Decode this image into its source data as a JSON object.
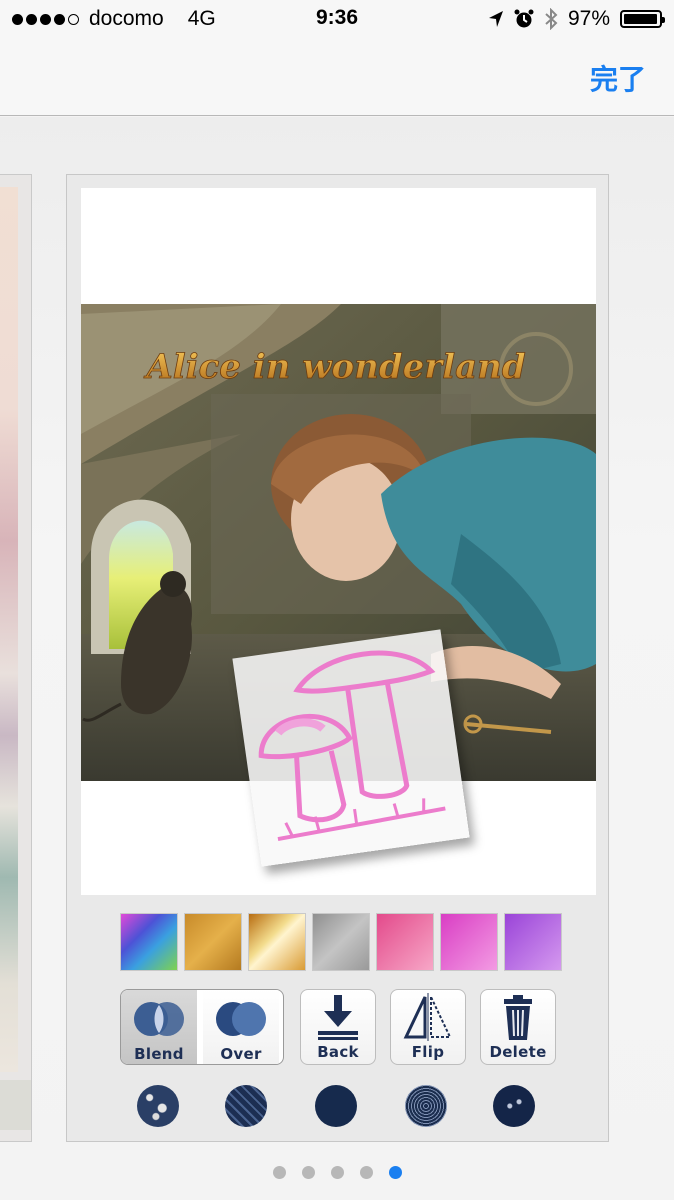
{
  "status_bar": {
    "carrier": "docomo",
    "network": "4G",
    "time": "9:36",
    "battery": "97%",
    "battery_level": 0.97,
    "signal_bars_filled": 4,
    "signal_bars_total": 5
  },
  "nav": {
    "done_label": "完了"
  },
  "artwork": {
    "title_text": "Alice in wonderland"
  },
  "swatches": [
    {
      "name": "rainbow",
      "color": "#5a62d8"
    },
    {
      "name": "gold",
      "color": "#d29a32"
    },
    {
      "name": "gold-shine",
      "color": "#e0ad3c"
    },
    {
      "name": "silver",
      "color": "#a4a4a4"
    },
    {
      "name": "pink",
      "color": "#ee5c9a"
    },
    {
      "name": "magenta",
      "color": "#e45ad0"
    },
    {
      "name": "violet",
      "color": "#b55fe0"
    }
  ],
  "tools": {
    "blend": "Blend",
    "over": "Over",
    "back": "Back",
    "flip": "Flip",
    "delete": "Delete",
    "selected": "Blend"
  },
  "textures": [
    "splatter",
    "scratched",
    "solid",
    "halftone",
    "speckled"
  ],
  "pagination": {
    "total": 5,
    "current": 5
  },
  "colors": {
    "accent": "#1a7ff0",
    "tool_label": "#1e2f55"
  }
}
